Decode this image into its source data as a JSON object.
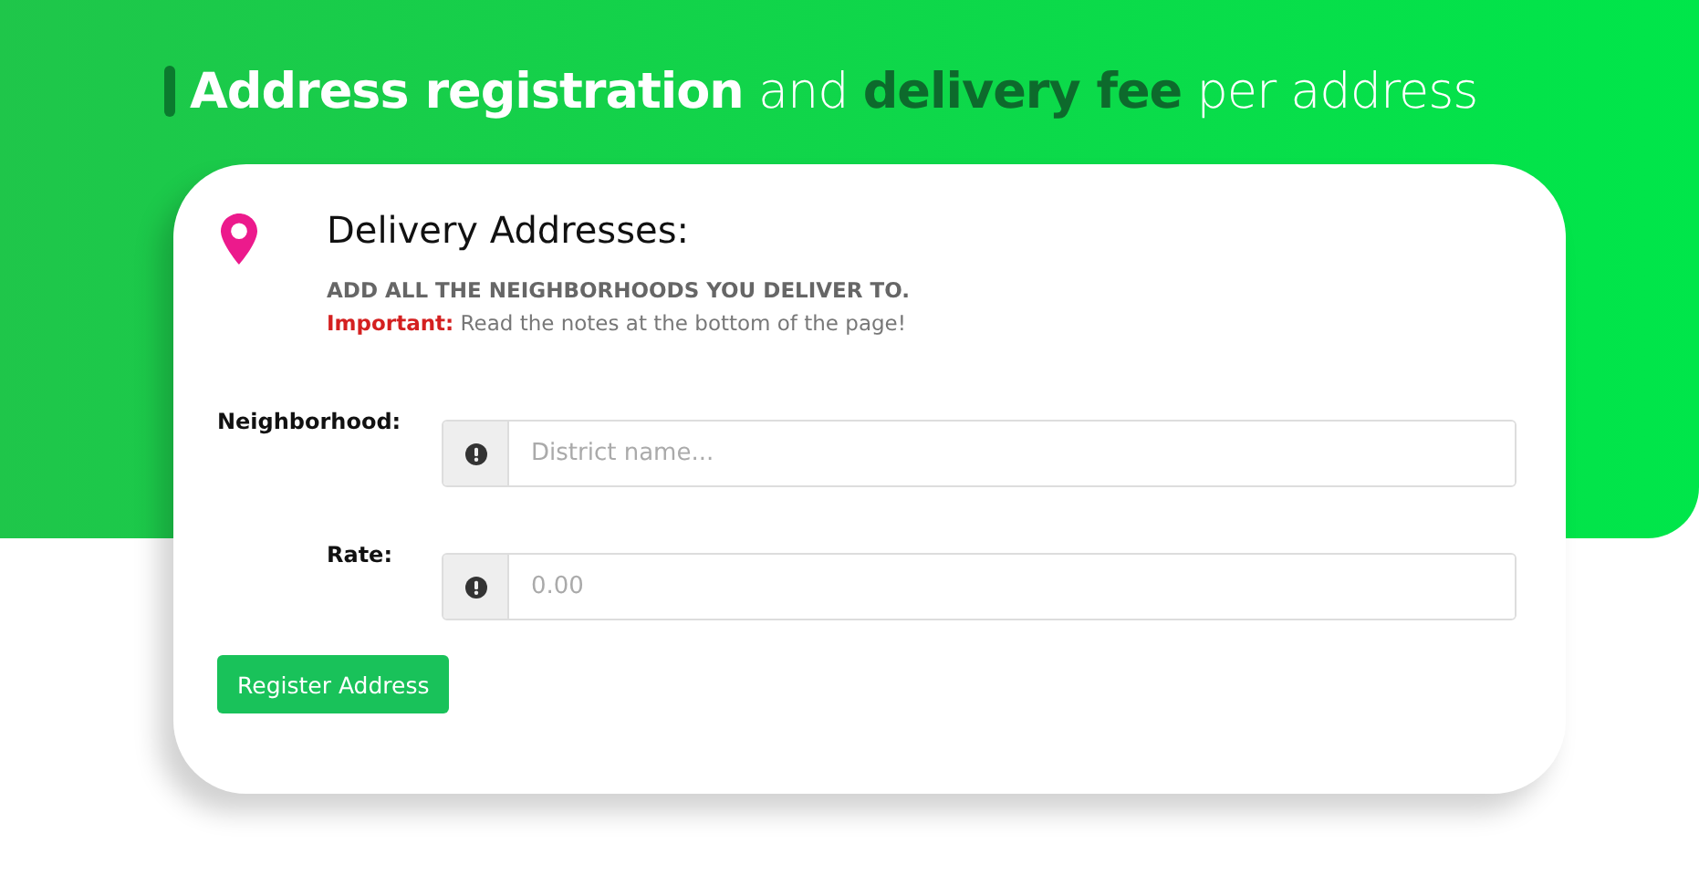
{
  "headline": [
    {
      "text": "Address registration",
      "kind": "strong"
    },
    {
      "text": "and",
      "kind": "plain"
    },
    {
      "text": "delivery fee",
      "kind": "accent"
    },
    {
      "text": "per address",
      "kind": "plain"
    }
  ],
  "card": {
    "title": "Delivery Addresses:",
    "subtitle": "ADD ALL THE NEIGHBORHOODS YOU DELIVER TO.",
    "note_label": "Important:",
    "note": "Read the notes at the bottom of the page!"
  },
  "fields": [
    {
      "label": "Neighborhood:",
      "placeholder": "District name..."
    },
    {
      "label": "Rate:",
      "placeholder": "0.00"
    }
  ],
  "button": "Register Address"
}
